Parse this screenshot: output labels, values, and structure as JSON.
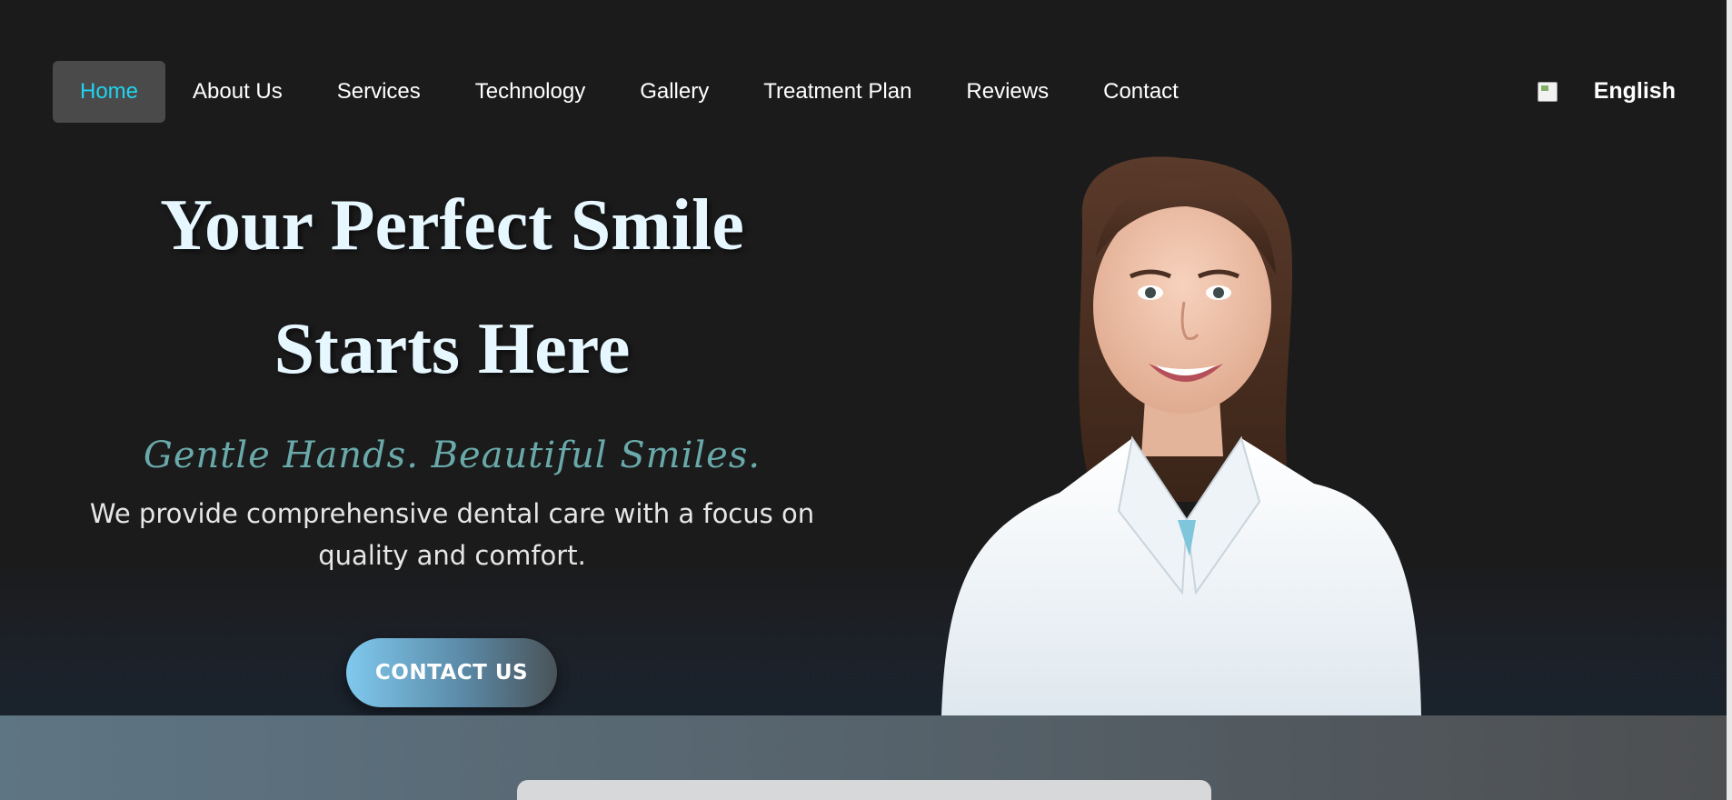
{
  "nav": {
    "items": [
      {
        "label": "Home",
        "active": true
      },
      {
        "label": "About Us"
      },
      {
        "label": "Services"
      },
      {
        "label": "Technology"
      },
      {
        "label": "Gallery"
      },
      {
        "label": "Treatment Plan"
      },
      {
        "label": "Reviews"
      },
      {
        "label": "Contact"
      }
    ],
    "language": {
      "label": "English",
      "flag_icon": "flag-icon"
    }
  },
  "hero": {
    "title_line1": "Your Perfect Smile",
    "title_line2": "Starts Here",
    "tagline": "Gentle Hands. Beautiful Smiles.",
    "description": "We provide comprehensive dental care with a focus on quality and comfort.",
    "cta_label": "CONTACT US"
  },
  "colors": {
    "background": "#1b1b1c",
    "accent_active": "#1fd4ef",
    "title": "#e6f7ff",
    "tagline": "#6aa9a9"
  }
}
